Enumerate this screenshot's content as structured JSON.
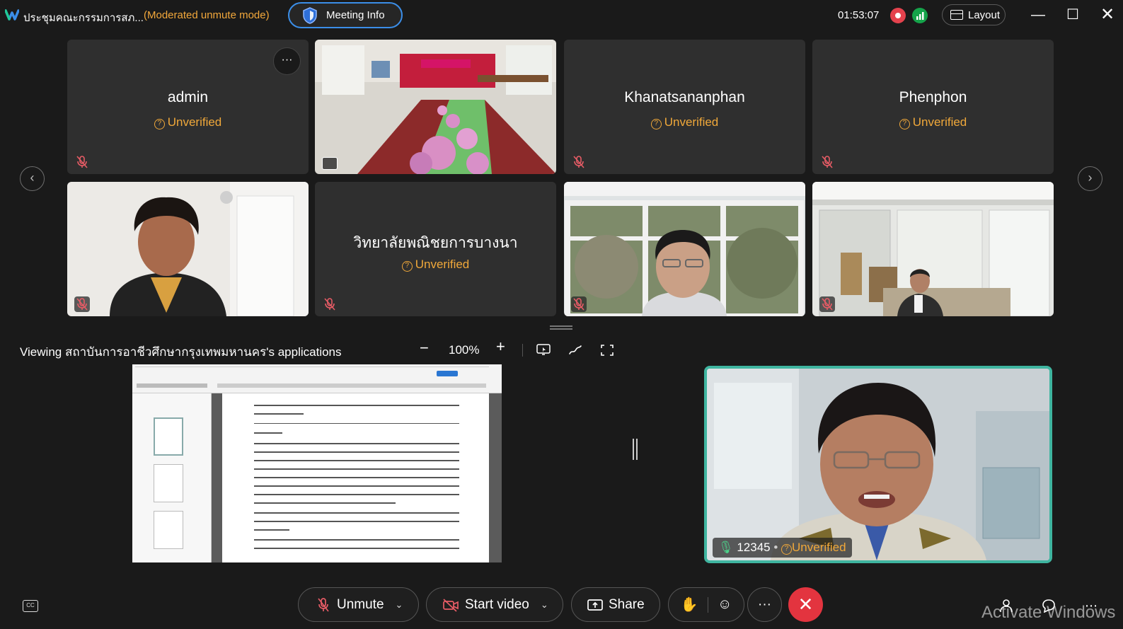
{
  "titlebar": {
    "meeting_title": "ประชุมคณะกรรมการสภ...",
    "mode": "(Moderated unmute mode)",
    "meeting_info": "Meeting Info",
    "timer": "01:53:07",
    "layout": "Layout"
  },
  "tiles": [
    {
      "name": "admin",
      "status": "Unverified",
      "video": false
    },
    {
      "name": "",
      "status": "",
      "video": true,
      "description": "conference-room"
    },
    {
      "name": "Khanatsananphan",
      "status": "Unverified",
      "video": false
    },
    {
      "name": "Phenphon",
      "status": "Unverified",
      "video": false
    },
    {
      "name": "",
      "status": "",
      "video": true,
      "description": "woman-at-desk"
    },
    {
      "name": "วิทยาลัยพณิชยการบางนา",
      "status": "Unverified",
      "video": false
    },
    {
      "name": "",
      "status": "",
      "video": true,
      "description": "man-window"
    },
    {
      "name": "",
      "status": "",
      "video": true,
      "description": "office-room"
    }
  ],
  "sharing": {
    "viewing_text": "Viewing สถาบันการอาชีวศึกษากรุงเทพมหานคร's applications",
    "zoom": "100%"
  },
  "speaker": {
    "name": "12345",
    "separator": "•",
    "status": "Unverified"
  },
  "controls": {
    "unmute": "Unmute",
    "start_video": "Start video",
    "share": "Share",
    "more": "···"
  },
  "watermark": "Activate Windows",
  "colors": {
    "accent_blue": "#3b8ee8",
    "warning_orange": "#f0a83a",
    "speaker_border": "#3fb5a0",
    "end_call": "#e3343f"
  }
}
